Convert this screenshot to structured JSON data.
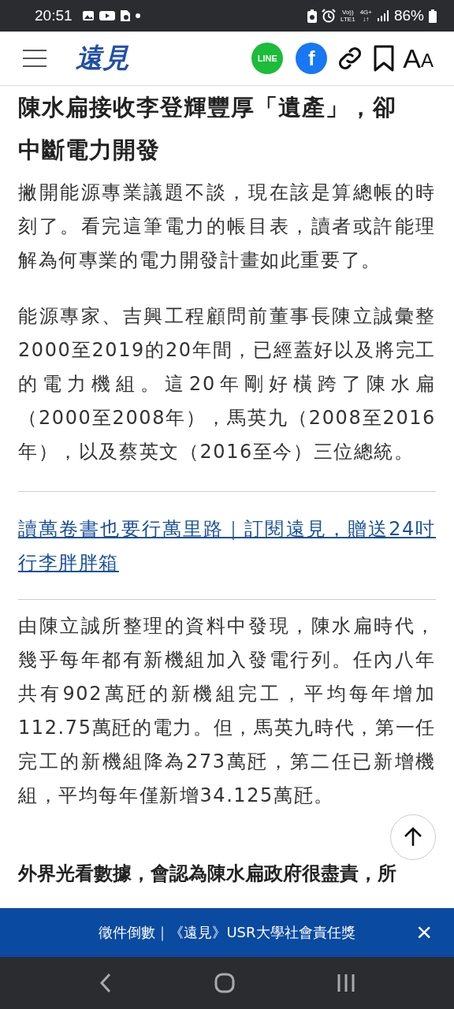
{
  "status_bar": {
    "time": "20:51",
    "volte": "Vo))",
    "lte": "LTE1",
    "network": "4G+",
    "data_arrows": "↓↑",
    "battery": "86%"
  },
  "header": {
    "logo": "遠見",
    "line_label": "LINE",
    "facebook_label": "f",
    "font_button": {
      "large": "A",
      "small": "A"
    }
  },
  "article": {
    "heading": "陳水扁接收李登輝豐厚「遺產」，卻中斷電力開發",
    "paragraphs": [
      {
        "kind": "text",
        "text": "撇開能源專業議題不談，現在該是算總帳的時刻了。看完這筆電力的帳目表，讀者或許能理解為何專業的電力開發計畫如此重要了。"
      },
      {
        "kind": "text",
        "text": "能源專家、吉興工程顧問前董事長陳立誠彙整2000至2019的20年間，已經蓋好以及將完工的電力機組。這20年剛好橫跨了陳水扁（2000至2008年），馬英九（2008至2016年），以及蔡英文（2016至今）三位總統。"
      },
      {
        "kind": "link",
        "text": "讀萬卷書也要行萬里路｜訂閱遠見，贈送24吋行李胖胖箱"
      },
      {
        "kind": "text",
        "text": "由陳立誠所整理的資料中發現，陳水扁時代，幾乎每年都有新機組加入發電行列。任內八年共有902萬瓩的新機組完工，平均每年增加112.75萬瓩的電力。但，馬英九時代，第一任完工的新機組降為273萬瓩，第二任已新增機組，平均每年僅新增34.125萬瓩。"
      },
      {
        "kind": "bold",
        "text": "外界光看數據，會認為陳水扁政府很盡責，所"
      }
    ]
  },
  "banner": {
    "text": "徵件倒數｜《遠見》USR大學社會責任獎",
    "close": "×"
  }
}
